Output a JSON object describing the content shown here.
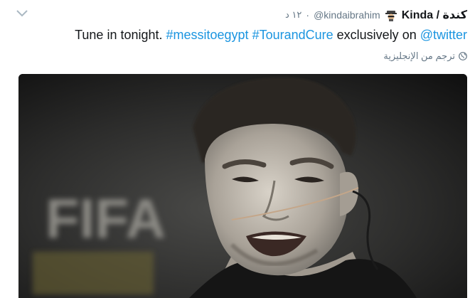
{
  "tweet": {
    "author_name": "Kinda / كندة",
    "author_emoji_icon": "spy-icon",
    "handle": "@kindaibrahim",
    "separator": "·",
    "time": "١٢ د",
    "text": {
      "plain": "Tune in tonight. ",
      "hashtag1": "#messitoegypt",
      "space1": " ",
      "hashtag2": "#TourandCure",
      "middle": " exclusively on ",
      "mention": "@twitter"
    },
    "translate_label": "ترجم من الإنجليزية",
    "translate_icon": "globe-icon",
    "menu_icon": "chevron-down-icon",
    "media": {
      "logo_text": "FIFA"
    }
  },
  "colors": {
    "link": "#1b95e0",
    "text": "#14171a",
    "muted": "#657786"
  }
}
